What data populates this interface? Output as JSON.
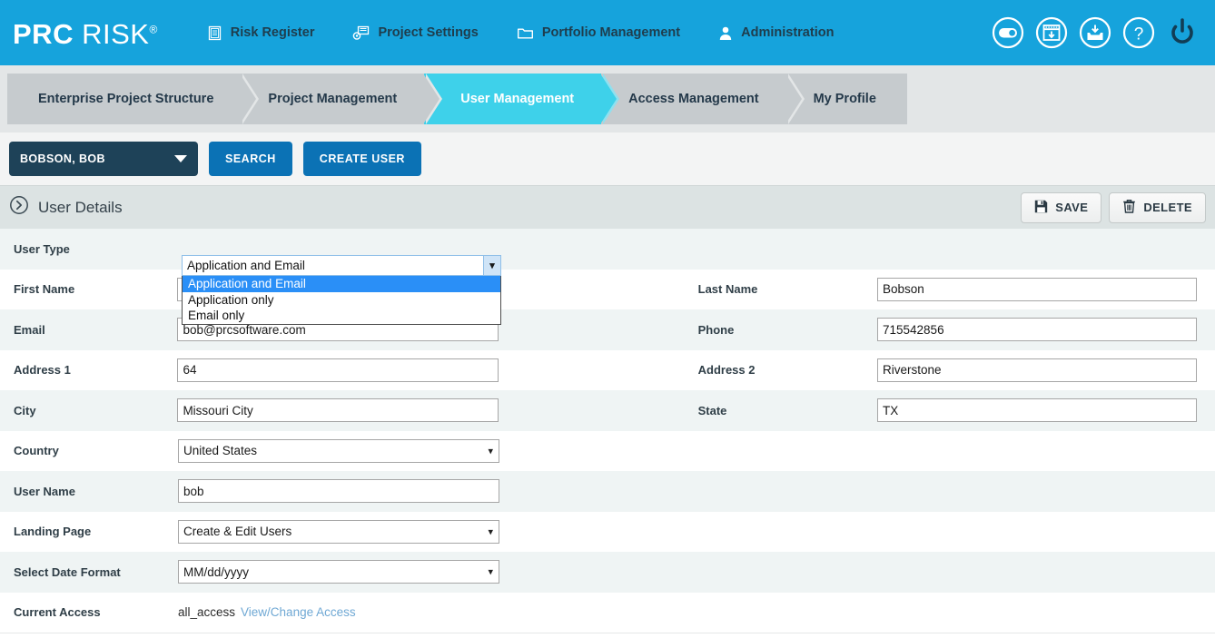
{
  "brand": {
    "bold": "PRC",
    "light": "RISK",
    "sup": "®"
  },
  "topnav": [
    {
      "label": "Risk Register",
      "icon": "list-document-icon"
    },
    {
      "label": "Project Settings",
      "icon": "project-settings-icon"
    },
    {
      "label": "Portfolio Management",
      "icon": "folder-icon"
    },
    {
      "label": "Administration",
      "icon": "user-icon"
    }
  ],
  "header_icons": [
    {
      "name": "toggle-icon"
    },
    {
      "name": "window-download-icon"
    },
    {
      "name": "inbox-download-icon"
    },
    {
      "name": "help-icon"
    },
    {
      "name": "power-icon"
    }
  ],
  "breadcrumb": {
    "tabs": [
      {
        "label": "Enterprise Project Structure",
        "active": false
      },
      {
        "label": "Project Management",
        "active": false
      },
      {
        "label": "User Management",
        "active": true
      },
      {
        "label": "Access Management",
        "active": false
      },
      {
        "label": "My Profile",
        "active": false
      }
    ]
  },
  "toolbar": {
    "user_selected": "BOBSON, BOB",
    "search_label": "SEARCH",
    "create_user_label": "CREATE USER"
  },
  "panel": {
    "title": "User Details",
    "save_label": "SAVE",
    "delete_label": "DELETE"
  },
  "form": {
    "user_type": {
      "label": "User Type",
      "value": "Application and Email",
      "options": [
        "Application and Email",
        "Application only",
        "Email only"
      ],
      "open": true,
      "highlighted": "Application and Email"
    },
    "first_name": {
      "label": "First Name",
      "value": ""
    },
    "last_name": {
      "label": "Last Name",
      "value": "Bobson"
    },
    "email": {
      "label": "Email",
      "value": "bob@prcsoftware.com"
    },
    "phone": {
      "label": "Phone",
      "value": "715542856"
    },
    "address1": {
      "label": "Address 1",
      "value": "64"
    },
    "address2": {
      "label": "Address 2",
      "value": "Riverstone"
    },
    "city": {
      "label": "City",
      "value": "Missouri City"
    },
    "state": {
      "label": "State",
      "value": "TX"
    },
    "country": {
      "label": "Country",
      "value": "United States"
    },
    "user_name": {
      "label": "User Name",
      "value": "bob"
    },
    "landing_page": {
      "label": "Landing Page",
      "value": "Create & Edit Users"
    },
    "date_format": {
      "label": "Select Date Format",
      "value": "MM/dd/yyyy"
    },
    "current_access": {
      "label": "Current Access",
      "value": "all_access",
      "link": "View/Change Access"
    }
  },
  "colors": {
    "header_blue": "#16a3dc",
    "active_tab_cyan": "#3ed1ea",
    "crumb_grey": "#c6cbce",
    "band_grey": "#e3e6e7",
    "dark_navy": "#1e4258",
    "button_blue": "#0b72b5",
    "row_alt": "#eff4f4",
    "dropdown_highlight": "#2a8ff7",
    "link_blue": "#6fa8d4"
  }
}
